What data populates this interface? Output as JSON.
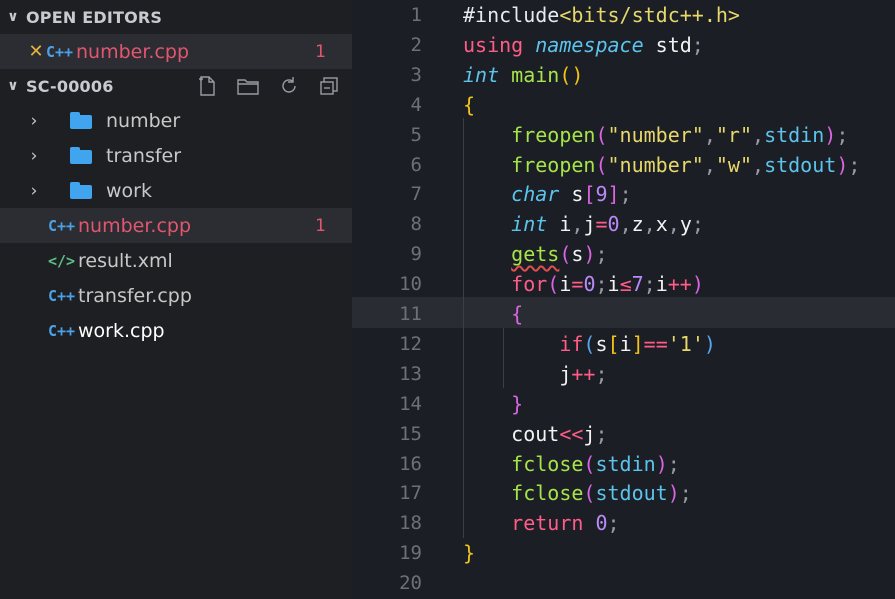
{
  "explorer": {
    "open_editors": {
      "title": "OPEN EDITORS",
      "files": [
        {
          "name": "number.cpp",
          "badge": "1",
          "icon": "cpp-icon",
          "icon_text": "C++"
        }
      ]
    },
    "project": {
      "title": "SC-00006",
      "folders": [
        {
          "name": "number"
        },
        {
          "name": "transfer"
        },
        {
          "name": "work"
        }
      ],
      "files": [
        {
          "name": "number.cpp",
          "badge": "1",
          "icon_text": "C++"
        },
        {
          "name": "result.xml",
          "icon_text": "</>"
        },
        {
          "name": "transfer.cpp",
          "icon_text": "C++"
        },
        {
          "name": "work.cpp",
          "icon_text": "C++"
        }
      ]
    },
    "icons": {
      "close": "✕",
      "chevron_down": "∨",
      "chevron_right": "›"
    }
  },
  "editor": {
    "line_numbers": [
      "1",
      "2",
      "3",
      "4",
      "5",
      "6",
      "7",
      "8",
      "9",
      "10",
      "11",
      "12",
      "13",
      "14",
      "15",
      "16",
      "17",
      "18",
      "19",
      "20"
    ],
    "lines": [
      [
        [
          "t-pre",
          "#include"
        ],
        [
          "t-str",
          "<bits/stdc++.h>"
        ]
      ],
      [
        [
          "t-kw",
          "using "
        ],
        [
          "t-ns",
          "namespace"
        ],
        [
          "t-plain",
          " std"
        ],
        [
          "t-punc",
          ";"
        ]
      ],
      [
        [
          "t-type",
          "int"
        ],
        [
          "t-plain",
          " "
        ],
        [
          "t-fn",
          "main"
        ],
        [
          "t-br1",
          "()"
        ]
      ],
      [
        [
          "t-br1",
          "{"
        ]
      ],
      [
        [
          "t-plain",
          "    "
        ],
        [
          "t-fn",
          "freopen"
        ],
        [
          "t-br2",
          "("
        ],
        [
          "t-str",
          "\"number\""
        ],
        [
          "t-punc",
          ","
        ],
        [
          "t-str",
          "\"r\""
        ],
        [
          "t-punc",
          ","
        ],
        [
          "t-const",
          "stdin"
        ],
        [
          "t-br2",
          ")"
        ],
        [
          "t-punc",
          ";"
        ]
      ],
      [
        [
          "t-plain",
          "    "
        ],
        [
          "t-fn",
          "freopen"
        ],
        [
          "t-br2",
          "("
        ],
        [
          "t-str",
          "\"number\""
        ],
        [
          "t-punc",
          ","
        ],
        [
          "t-str",
          "\"w\""
        ],
        [
          "t-punc",
          ","
        ],
        [
          "t-const",
          "stdout"
        ],
        [
          "t-br2",
          ")"
        ],
        [
          "t-punc",
          ";"
        ]
      ],
      [
        [
          "t-plain",
          "    "
        ],
        [
          "t-type",
          "char"
        ],
        [
          "t-plain",
          " s"
        ],
        [
          "t-br2",
          "["
        ],
        [
          "t-num",
          "9"
        ],
        [
          "t-br2",
          "]"
        ],
        [
          "t-punc",
          ";"
        ]
      ],
      [
        [
          "t-plain",
          "    "
        ],
        [
          "t-type",
          "int"
        ],
        [
          "t-plain",
          " i"
        ],
        [
          "t-punc",
          ","
        ],
        [
          "t-plain",
          "j"
        ],
        [
          "t-op",
          "="
        ],
        [
          "t-num",
          "0"
        ],
        [
          "t-punc",
          ","
        ],
        [
          "t-plain",
          "z"
        ],
        [
          "t-punc",
          ","
        ],
        [
          "t-plain",
          "x"
        ],
        [
          "t-punc",
          ","
        ],
        [
          "t-plain",
          "y"
        ],
        [
          "t-punc",
          ";"
        ]
      ],
      [
        [
          "t-plain",
          "    "
        ],
        [
          "t-fn squiggle",
          "gets"
        ],
        [
          "t-br2",
          "("
        ],
        [
          "t-plain",
          "s"
        ],
        [
          "t-br2",
          ")"
        ],
        [
          "t-punc",
          ";"
        ]
      ],
      [
        [
          "t-plain",
          "    "
        ],
        [
          "t-kw",
          "for"
        ],
        [
          "t-br2",
          "("
        ],
        [
          "t-plain",
          "i"
        ],
        [
          "t-op",
          "="
        ],
        [
          "t-num",
          "0"
        ],
        [
          "t-punc",
          ";"
        ],
        [
          "t-plain",
          "i"
        ],
        [
          "t-op",
          "≤"
        ],
        [
          "t-num",
          "7"
        ],
        [
          "t-punc",
          ";"
        ],
        [
          "t-plain",
          "i"
        ],
        [
          "t-op",
          "++"
        ],
        [
          "t-br2",
          ")"
        ]
      ],
      [
        [
          "t-plain",
          "    "
        ],
        [
          "t-br2",
          "{"
        ]
      ],
      [
        [
          "t-plain",
          "        "
        ],
        [
          "t-kw",
          "if"
        ],
        [
          "t-br3",
          "("
        ],
        [
          "t-plain",
          "s"
        ],
        [
          "t-br1",
          "["
        ],
        [
          "t-plain",
          "i"
        ],
        [
          "t-br1",
          "]"
        ],
        [
          "t-op",
          "=="
        ],
        [
          "t-str",
          "'1'"
        ],
        [
          "t-br3",
          ")"
        ]
      ],
      [
        [
          "t-plain",
          "        j"
        ],
        [
          "t-op",
          "++"
        ],
        [
          "t-punc",
          ";"
        ]
      ],
      [
        [
          "t-plain",
          "    "
        ],
        [
          "t-br2",
          "}"
        ]
      ],
      [
        [
          "t-plain",
          "    cout"
        ],
        [
          "t-op",
          "<<"
        ],
        [
          "t-plain",
          "j"
        ],
        [
          "t-punc",
          ";"
        ]
      ],
      [
        [
          "t-plain",
          "    "
        ],
        [
          "t-fn",
          "fclose"
        ],
        [
          "t-br2",
          "("
        ],
        [
          "t-const",
          "stdin"
        ],
        [
          "t-br2",
          ")"
        ],
        [
          "t-punc",
          ";"
        ]
      ],
      [
        [
          "t-plain",
          "    "
        ],
        [
          "t-fn",
          "fclose"
        ],
        [
          "t-br2",
          "("
        ],
        [
          "t-const",
          "stdout"
        ],
        [
          "t-br2",
          ")"
        ],
        [
          "t-punc",
          ";"
        ]
      ],
      [
        [
          "t-plain",
          "    "
        ],
        [
          "t-kw",
          "return"
        ],
        [
          "t-plain",
          " "
        ],
        [
          "t-num",
          "0"
        ],
        [
          "t-punc",
          ";"
        ]
      ],
      [
        [
          "t-br1",
          "}"
        ]
      ],
      []
    ]
  },
  "colors": {
    "error": "#e2566f",
    "sidebar_bg": "#1e1f23",
    "editor_bg": "#1b1e25"
  }
}
